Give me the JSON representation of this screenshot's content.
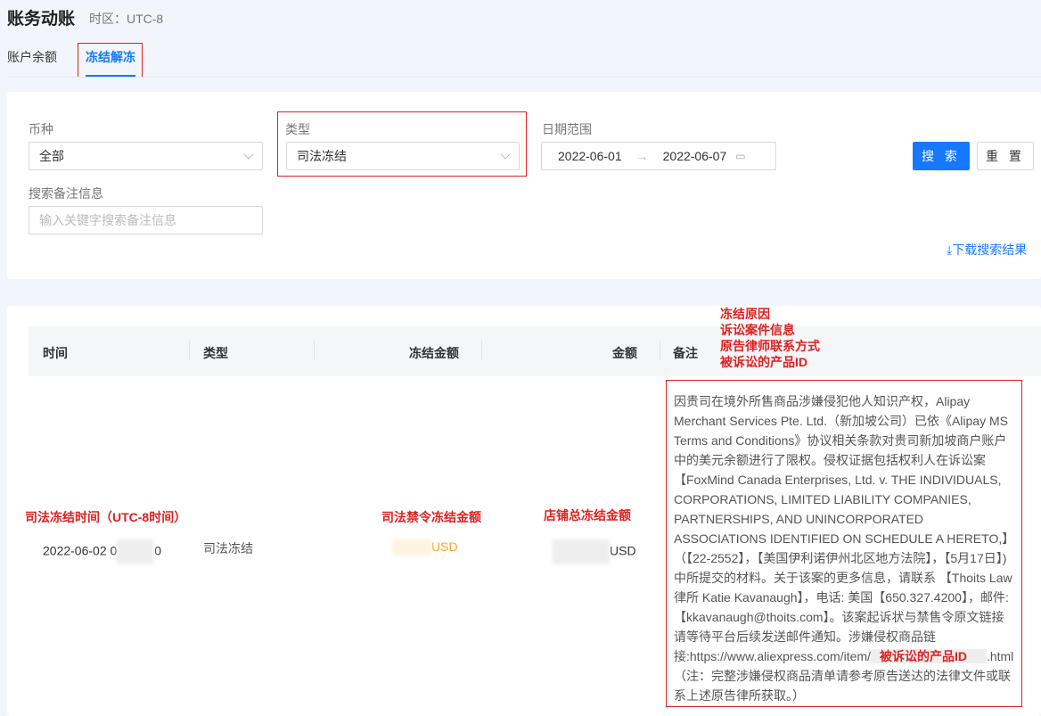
{
  "header": {
    "title": "账务动账",
    "timezone": "时区：UTC-8"
  },
  "tabs": [
    {
      "label": "账户余额",
      "active": false
    },
    {
      "label": "冻结解冻",
      "active": true
    }
  ],
  "filters": {
    "currency": {
      "label": "币种",
      "value": "全部"
    },
    "type": {
      "label": "类型",
      "value": "司法冻结"
    },
    "date_range": {
      "label": "日期范围",
      "start": "2022-06-01",
      "end": "2022-06-07"
    },
    "remark_search": {
      "label": "搜索备注信息",
      "placeholder": "输入关键字搜索备注信息"
    },
    "search_button": "搜 索",
    "reset_button": "重 置",
    "download_link": "下载搜索结果"
  },
  "table": {
    "columns": [
      "时间",
      "类型",
      "冻结金额",
      "金额",
      "备注"
    ],
    "rows": [
      {
        "time": "2022-06-02 0",
        "time_end": "0",
        "type": "司法冻结",
        "frozen_currency": "USD",
        "amount_currency": "USD",
        "remark_before": "因贵司在境外所售商品涉嫌侵犯他人知识产权，Alipay Merchant Services Pte. Ltd.（新加坡公司）已依《Alipay MS Terms and Conditions》协议相关条款对贵司新加坡商户账户中的美元余额进行了限权。侵权证据包括权利人在诉讼案【FoxMind Canada Enterprises, Ltd. v. THE INDIVIDUALS, CORPORATIONS, LIMITED LIABILITY COMPANIES, PARTNERSHIPS, AND UNINCORPORATED ASSOCIATIONS IDENTIFIED ON SCHEDULE A HERETO,】（【22-2552】，【美国伊利诺伊州北区地方法院】，【5月17日】)中所提交的材料。关于该案的更多信息，请联系 【Thoits Law律所 Katie Kavanaugh】，电话: 美国【650.327.4200】，邮件:【kkavanaugh@thoits.com】。该案起诉状与禁售令原文链接请等待平台后续发送邮件通知。涉嫌侵权商品链接:https://www.aliexpress.com/item/",
        "remark_highlight": "被诉讼的产品ID",
        "remark_after": ".html（注：完整涉嫌侵权商品清单请参考原告送达的法律文件或联系上述原告律所获取。）"
      }
    ]
  },
  "annotations": {
    "time": "司法冻结时间（UTC-8时间）",
    "frozen_amount": "司法禁令冻结金额",
    "total_amount": "店铺总冻结金额",
    "remark": [
      "冻结原因",
      "诉讼案件信息",
      "原告律师联系方式",
      "被诉讼的产品ID"
    ]
  },
  "colors": {
    "primary": "#1677ff",
    "annotation": "#e02020",
    "frozen_currency": "#f5a623"
  }
}
